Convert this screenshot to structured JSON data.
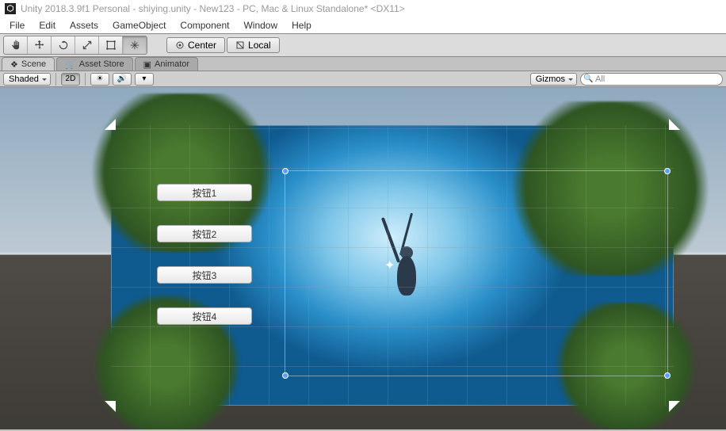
{
  "titlebar": "Unity 2018.3.9f1 Personal - shiying.unity - New123 - PC, Mac & Linux Standalone* <DX11>",
  "menu": {
    "file": "File",
    "edit": "Edit",
    "assets": "Assets",
    "gameobject": "GameObject",
    "component": "Component",
    "window": "Window",
    "help": "Help"
  },
  "toolbar": {
    "center": "Center",
    "local": "Local"
  },
  "tabs": {
    "scene": "Scene",
    "assetstore": "Asset Store",
    "animator": "Animator"
  },
  "scene_toolbar": {
    "shading": "Shaded",
    "mode2d": "2D",
    "gizmos": "Gizmos",
    "search_placeholder": "All"
  },
  "game_buttons": [
    "按钮1",
    "按钮2",
    "按钮3",
    "按钮4"
  ]
}
